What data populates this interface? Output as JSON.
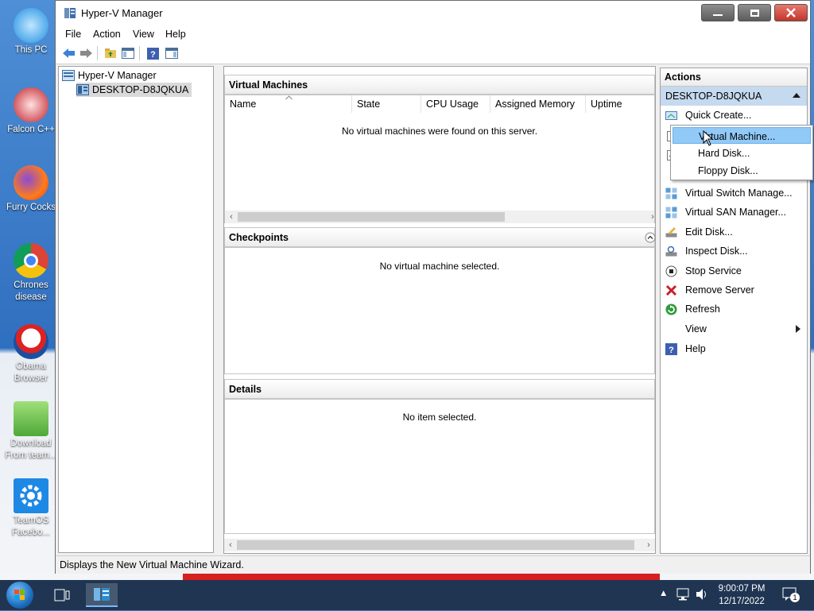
{
  "desktop": {
    "icons": [
      {
        "label": "This PC",
        "icon": "monitor-icon"
      },
      {
        "label": "Falcon C++",
        "icon": "falcon-icon"
      },
      {
        "label": "Furry Cocks",
        "icon": "firefox-icon"
      },
      {
        "label": "Chrones disease",
        "icon": "chrome-icon"
      },
      {
        "label": "Obama Browser",
        "icon": "obama-logo-icon"
      },
      {
        "label": "Download From team...",
        "icon": "notepad-icon"
      },
      {
        "label": "TeamOS Facebo...",
        "icon": "gear-icon"
      }
    ]
  },
  "window": {
    "title": "Hyper-V Manager",
    "menu": [
      "File",
      "Action",
      "View",
      "Help"
    ],
    "tree": {
      "root": "Hyper-V Manager",
      "host": "DESKTOP-D8JQKUA"
    },
    "virtual_machines": {
      "header": "Virtual Machines",
      "columns": [
        "Name",
        "State",
        "CPU Usage",
        "Assigned Memory",
        "Uptime"
      ],
      "empty_message": "No virtual machines were found on this server."
    },
    "checkpoints": {
      "header": "Checkpoints",
      "empty_message": "No virtual machine selected."
    },
    "details": {
      "header": "Details",
      "empty_message": "No item selected."
    },
    "actions": {
      "header": "Actions",
      "host": "DESKTOP-D8JQKUA",
      "items": [
        {
          "label": "Quick Create...",
          "icon": "quick-create-icon"
        },
        {
          "label": "Virtual Switch Manage...",
          "icon": "switch-icon"
        },
        {
          "label": "Virtual SAN Manager...",
          "icon": "san-icon"
        },
        {
          "label": "Edit Disk...",
          "icon": "edit-disk-icon"
        },
        {
          "label": "Inspect Disk...",
          "icon": "inspect-disk-icon"
        },
        {
          "label": "Stop Service",
          "icon": "stop-icon"
        },
        {
          "label": "Remove Server",
          "icon": "remove-icon"
        },
        {
          "label": "Refresh",
          "icon": "refresh-icon"
        },
        {
          "label": "View",
          "icon": ""
        },
        {
          "label": "Help",
          "icon": "help-icon"
        }
      ]
    },
    "new_submenu": [
      "Virtual Machine...",
      "Hard Disk...",
      "Floppy Disk..."
    ],
    "status_text": "Displays the New Virtual Machine Wizard."
  },
  "taskbar": {
    "time": "9:00:07 PM",
    "date": "12/17/2022",
    "notification_count": "1"
  }
}
